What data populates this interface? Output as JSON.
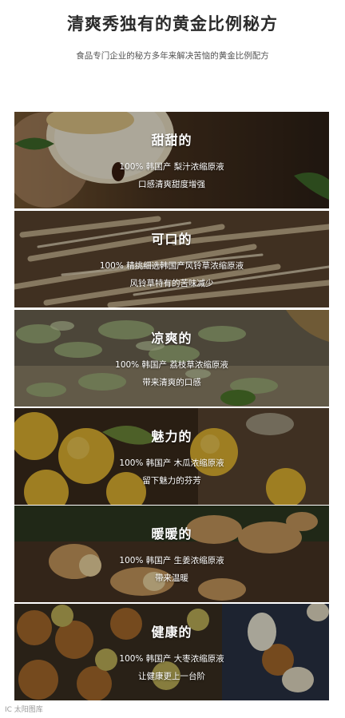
{
  "header": {
    "title": "清爽秀独有的黄金比例秘方",
    "subtitle": "食品专门企业的秘方多年来解决苦恼的黄金比例配方"
  },
  "panels": [
    {
      "heading": "甜甜的",
      "line1": "100% 韩国产  梨汁浓缩原液",
      "line2": "口感清爽甜度增强",
      "image": "pear"
    },
    {
      "heading": "可口的",
      "line1": "100% 精挑细选韩国产风铃草浓缩原液",
      "line2": "风铃草特有的苦味减少",
      "image": "bellflower-root"
    },
    {
      "heading": "凉爽的",
      "line1": "100% 韩国产  荔枝草浓缩原液",
      "line2": "带来清爽的口感",
      "image": "dried-herb"
    },
    {
      "heading": "魅力的",
      "line1": "100% 韩国产  木瓜浓缩原液",
      "line2": "留下魅力的芬芳",
      "image": "quince"
    },
    {
      "heading": "暖暖的",
      "line1": "100% 韩国产  生姜浓缩原液",
      "line2": "带来温暖",
      "image": "ginger"
    },
    {
      "heading": "健康的",
      "line1": "100% 韩国产  大枣浓缩原液",
      "line2": "让健康更上一台阶",
      "image": "jujube"
    }
  ],
  "watermark": "IC 太阳图库"
}
